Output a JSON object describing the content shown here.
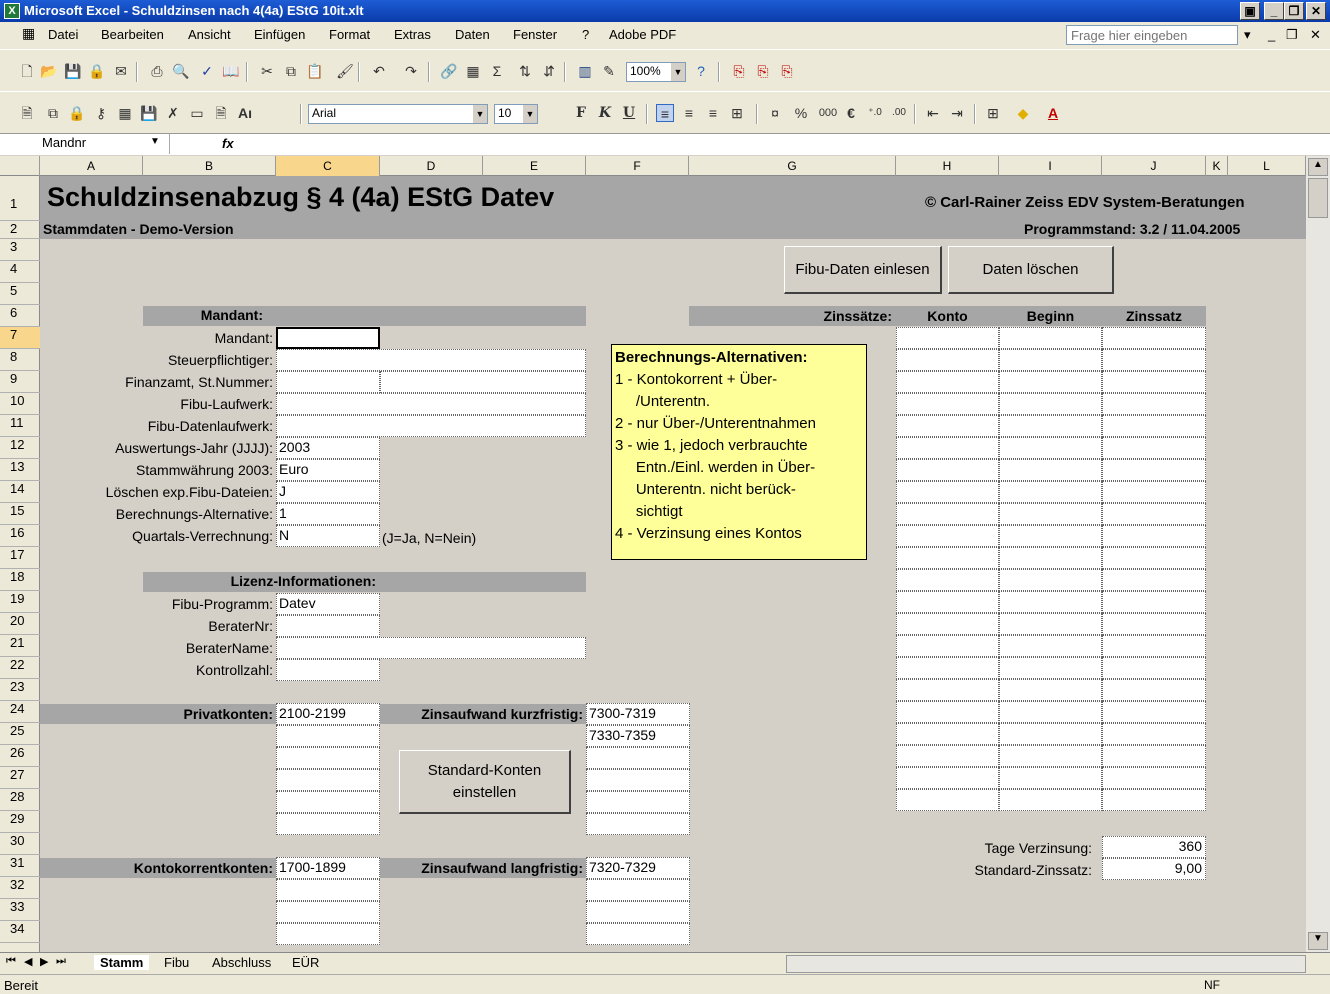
{
  "window": {
    "title": "Microsoft Excel - Schuldzinsen nach 4(4a) EStG 10it.xlt"
  },
  "menu": [
    "Datei",
    "Bearbeiten",
    "Ansicht",
    "Einfügen",
    "Format",
    "Extras",
    "Daten",
    "Fenster",
    "?",
    "Adobe PDF"
  ],
  "ask_placeholder": "Frage hier eingeben",
  "toolbar": {
    "zoom": "100%",
    "font": "Arial",
    "size": "10",
    "percent": "%",
    "thousands": "000",
    "euro": "€",
    "bold": "F",
    "italic": "K",
    "underline": "U"
  },
  "formula_bar": {
    "name_box": "Mandnr",
    "fx": "fx"
  },
  "columns": [
    "A",
    "B",
    "C",
    "D",
    "E",
    "F",
    "G",
    "H",
    "I",
    "J",
    "K",
    "L"
  ],
  "rows": [
    "1",
    "2",
    "3",
    "4",
    "5",
    "6",
    "7",
    "8",
    "9",
    "10",
    "11",
    "12",
    "13",
    "14",
    "15",
    "16",
    "17",
    "18",
    "19",
    "20",
    "21",
    "22",
    "23",
    "24",
    "25",
    "26",
    "27",
    "28",
    "29",
    "30",
    "31",
    "32",
    "33",
    "34"
  ],
  "sheet": {
    "title": "Schuldzinsenabzug § 4 (4a) EStG Datev",
    "copyright": "© Carl-Rainer Zeiss EDV System-Beratungen",
    "subtitle": "Stammdaten  - Demo-Version",
    "version": "Programmstand: 3.2 / 11.04.2005",
    "btn_read": "Fibu-Daten einlesen",
    "btn_delete": "Daten löschen",
    "mandant_header": "Mandant:",
    "labels": {
      "mandant": "Mandant:",
      "steuer": "Steuerpflichtiger:",
      "finanzamt": "Finanzamt, St.Nummer:",
      "laufwerk": "Fibu-Laufwerk:",
      "datenlaufwerk": "Fibu-Datenlaufwerk:",
      "jahr": "Auswertungs-Jahr (JJJJ):",
      "waehrung": "Stammwährung 2003:",
      "loeschen": "Löschen exp.Fibu-Dateien:",
      "alternative": "Berechnungs-Alternative:",
      "quartal": "Quartals-Verrechnung:"
    },
    "values": {
      "jahr": "2003",
      "waehrung": "Euro",
      "loeschen": "J",
      "alternative": "1",
      "quartal": "N"
    },
    "jn_hint": "(J=Ja, N=Nein)",
    "lizenz_header": "Lizenz-Informationen:",
    "lizenz": {
      "programm_label": "Fibu-Programm:",
      "programm": "Datev",
      "beraternr": "BeraterNr:",
      "beratername": "BeraterName:",
      "kontrollzahl": "Kontrollzahl:"
    },
    "privat_label": "Privatkonten:",
    "privat_value": "2100-2199",
    "kurz_label": "Zinsaufwand kurzfristig:",
    "kurz_values": [
      "7300-7319",
      "7330-7359"
    ],
    "btn_standard_1": "Standard-Konten",
    "btn_standard_2": "einstellen",
    "kk_label": "Kontokorrentkonten:",
    "kk_value": "1700-1899",
    "lang_label": "Zinsaufwand langfristig:",
    "lang_value": "7320-7329",
    "zins_headers": {
      "zinssaetze": "Zinssätze:",
      "konto": "Konto",
      "beginn": "Beginn",
      "zinssatz": "Zinssatz"
    },
    "tage_label": "Tage Verzinsung:",
    "tage_value": "360",
    "std_label": "Standard-Zinssatz:",
    "std_value": "9,00",
    "note_title": "Berechnungs-Alternativen:",
    "note_lines": [
      "1 - Kontokorrent + Über-",
      "     /Unterentn.",
      "2 - nur Über-/Unterentnahmen",
      "3 - wie 1, jedoch verbrauchte",
      "     Entn./Einl. werden in Über-",
      "     Unterentn. nicht berück-",
      "     sichtigt",
      "4 - Verzinsung eines Kontos"
    ]
  },
  "tabs": [
    "Stamm",
    "Fibu",
    "Abschluss",
    "EÜR"
  ],
  "status": {
    "left": "Bereit",
    "right": "NF"
  },
  "colors": {
    "titlebar": "#0a3aa8",
    "band": "#a6a6a6",
    "note": "#ffff99",
    "selection": "#f8d68c"
  }
}
